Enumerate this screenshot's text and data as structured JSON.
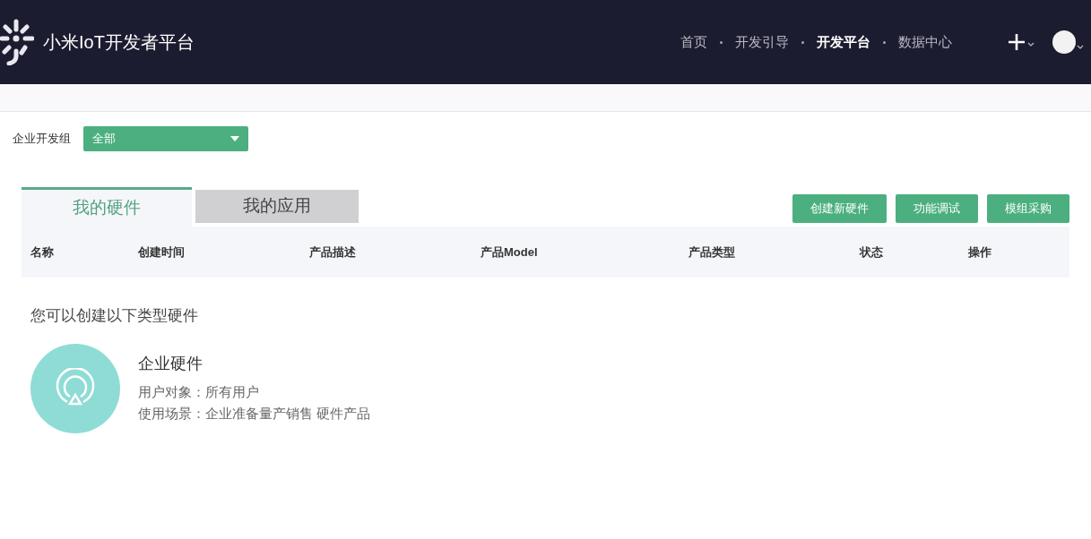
{
  "header": {
    "title": "小米IoT开发者平台",
    "nav": [
      {
        "label": "首页",
        "selected": false
      },
      {
        "label": "开发引导",
        "selected": false
      },
      {
        "label": "开发平台",
        "selected": true
      },
      {
        "label": "数据中心",
        "selected": false
      }
    ]
  },
  "filter": {
    "label": "企业开发组",
    "value": "全部"
  },
  "tabs": [
    {
      "label": "我的硬件",
      "selected": true
    },
    {
      "label": "我的应用",
      "selected": false
    }
  ],
  "buttons": [
    "创建新硬件",
    "功能调试",
    "模组采购"
  ],
  "table": {
    "columns": [
      "名称",
      "创建时间",
      "产品描述",
      "产品Model",
      "产品类型",
      "状态",
      "操作"
    ]
  },
  "create_section": {
    "heading": "您可以创建以下类型硬件",
    "types": [
      {
        "name": "企业硬件",
        "lines": [
          "用户对象：所有用户",
          "使用场景：企业准备量产销售 硬件产品"
        ]
      }
    ]
  }
}
